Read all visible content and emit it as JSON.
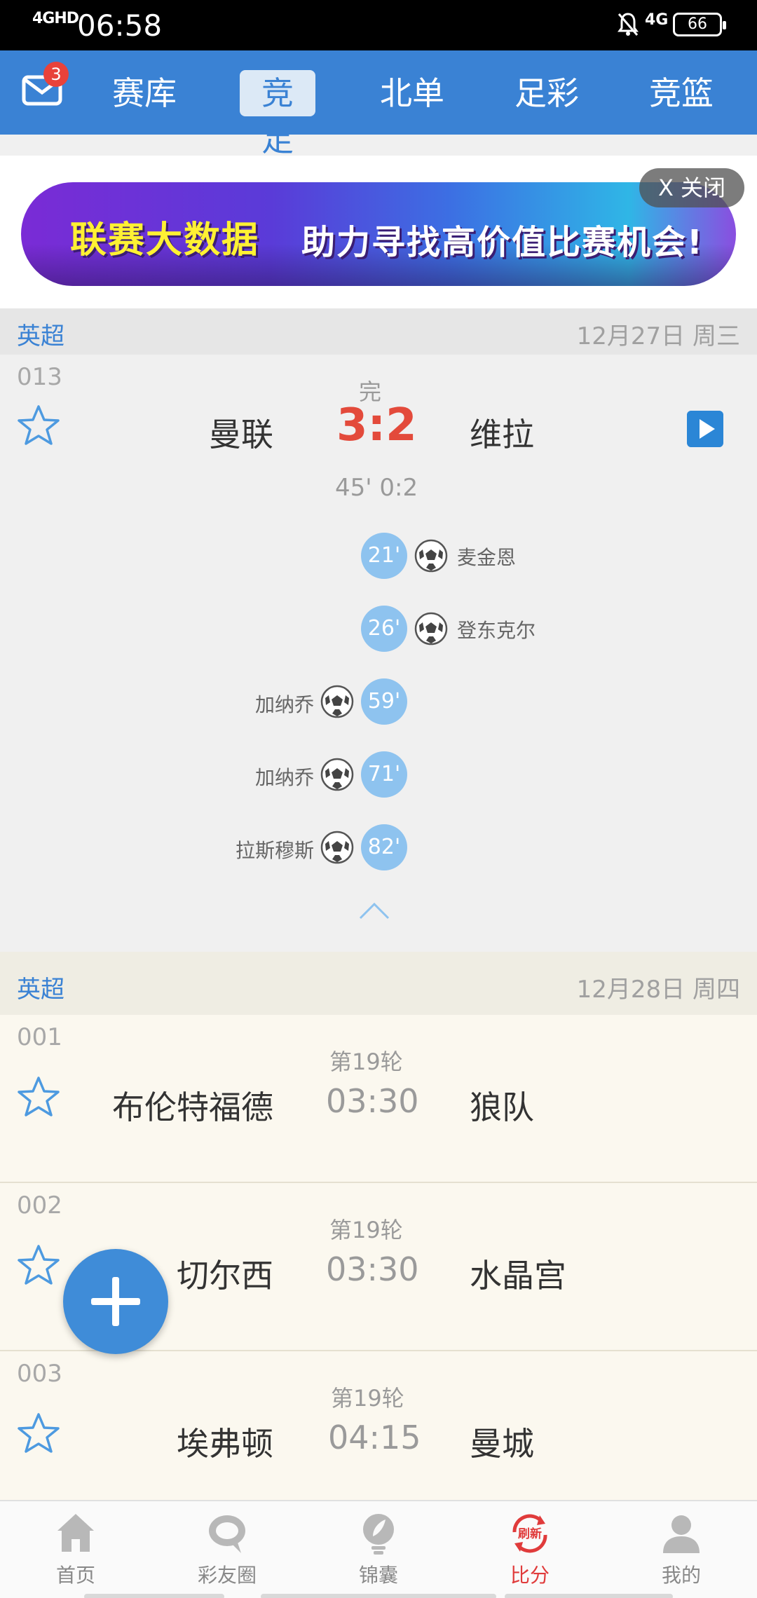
{
  "status_bar": {
    "network": "4GHD",
    "time": "06:58",
    "signal2": "4G",
    "battery": "66"
  },
  "nav": {
    "mail_badge": "3",
    "tabs": [
      "赛库",
      "竞足",
      "北单",
      "足彩",
      "竞篮"
    ],
    "active_tab": "竞足"
  },
  "ad": {
    "text1": "联赛大数据",
    "text2": "助力寻找高价值比赛机会!",
    "close_label": "X 关闭"
  },
  "section1": {
    "league": "英超",
    "date": "12月27日 周三",
    "match": {
      "number": "013",
      "status": "完",
      "home": "曼联",
      "score": "3:2",
      "away": "维拉",
      "halftime": "45' 0:2",
      "events": [
        {
          "side": "away",
          "minute": "21'",
          "player": "麦金恩"
        },
        {
          "side": "away",
          "minute": "26'",
          "player": "登东克尔"
        },
        {
          "side": "home",
          "minute": "59'",
          "player": "加纳乔"
        },
        {
          "side": "home",
          "minute": "71'",
          "player": "加纳乔"
        },
        {
          "side": "home",
          "minute": "82'",
          "player": "拉斯穆斯"
        }
      ]
    }
  },
  "section2": {
    "league": "英超",
    "date": "12月28日 周四",
    "matches": [
      {
        "number": "001",
        "round": "第19轮",
        "home": "布伦特福德",
        "time": "03:30",
        "away": "狼队"
      },
      {
        "number": "002",
        "round": "第19轮",
        "home": "切尔西",
        "time": "03:30",
        "away": "水晶宫"
      },
      {
        "number": "003",
        "round": "第19轮",
        "home": "埃弗顿",
        "time": "04:15",
        "away": "曼城"
      }
    ]
  },
  "bottom_nav": {
    "items": [
      {
        "label": "首页",
        "icon": "home-icon"
      },
      {
        "label": "彩友圈",
        "icon": "chat-icon"
      },
      {
        "label": "锦囊",
        "icon": "tips-icon"
      },
      {
        "label": "比分",
        "icon": "refresh-score-icon",
        "badge_text": "刷新"
      },
      {
        "label": "我的",
        "icon": "user-icon"
      }
    ],
    "active": "比分"
  },
  "colors": {
    "brand_blue": "#3a82d4",
    "score_red": "#e34a3b",
    "minute_blue": "#8ec3ef"
  }
}
